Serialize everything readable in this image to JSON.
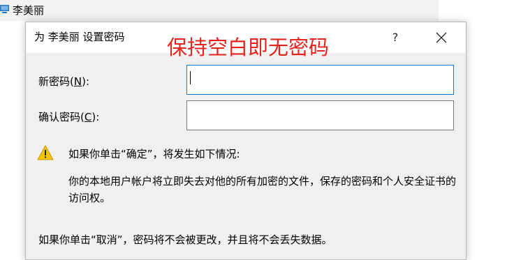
{
  "background": {
    "user_name": "李美丽"
  },
  "dialog": {
    "title": "为 李美丽 设置密码",
    "annotation": "保持空白即无密码",
    "help_label": "?",
    "new_password": {
      "label_prefix": "新密码(",
      "label_key": "N",
      "label_suffix": "):",
      "value": ""
    },
    "confirm_password": {
      "label_prefix": "确认密码(",
      "label_key": "C",
      "label_suffix": "):",
      "value": ""
    },
    "warning_heading": "如果你单击“确定”，将发生如下情况:",
    "warning_body": "你的本地用户帐户将立即失去对他的所有加密的文件，保存的密码和个人安全证书的访问权。",
    "cancel_note": "如果你单击“取消”，密码将不会被更改，并且将不会丢失数据。"
  },
  "colors": {
    "annotation": "#e8231e",
    "focus_border": "#0078d7",
    "warning_fill": "#f5c500"
  }
}
